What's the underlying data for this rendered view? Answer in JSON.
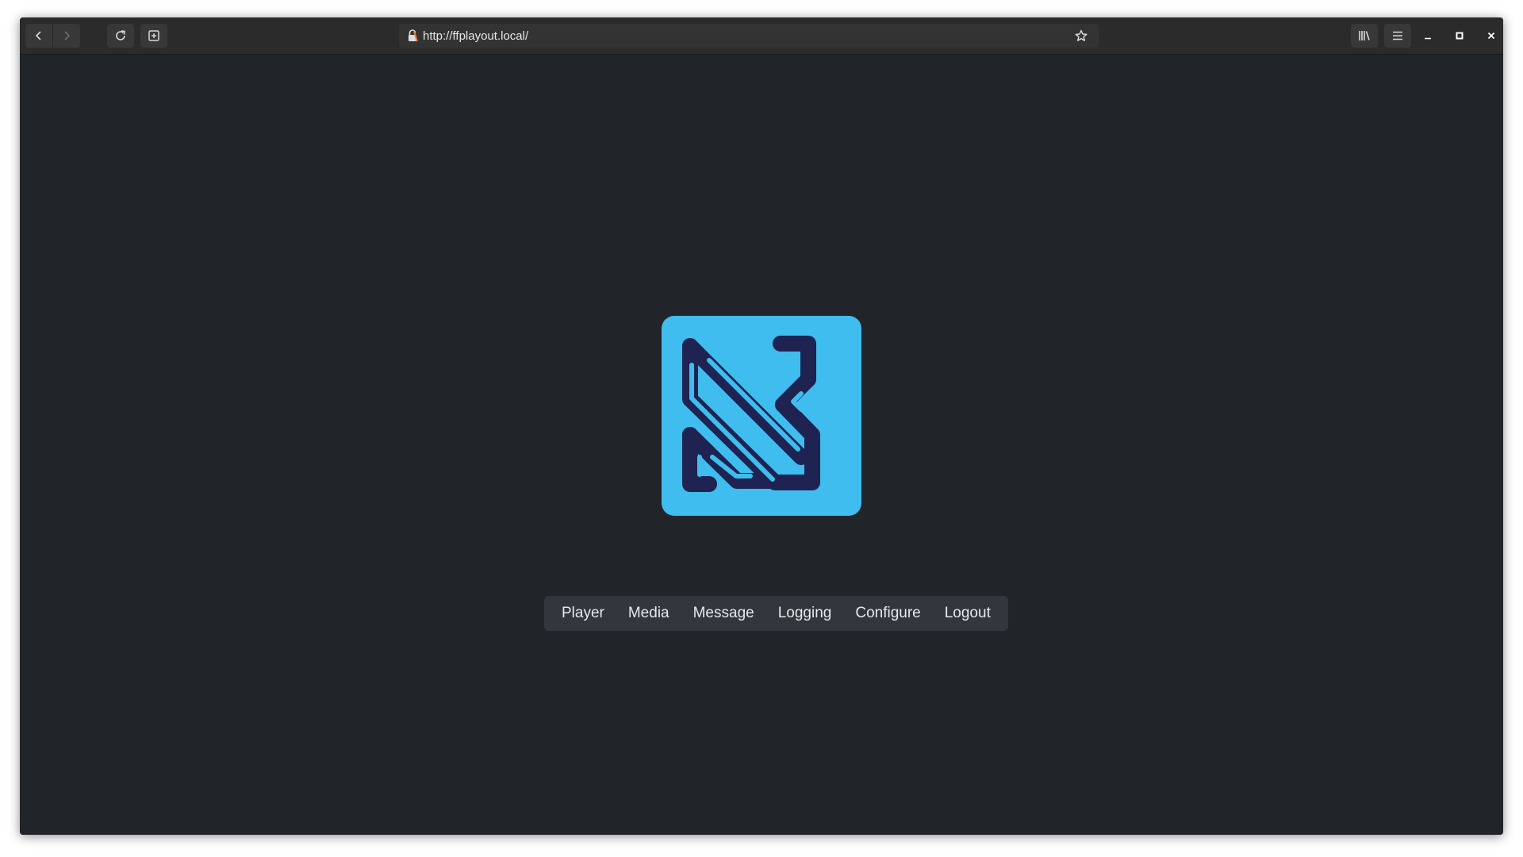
{
  "browser": {
    "url": "http://ffplayout.local/",
    "icons": {
      "back": "chevron-left-icon",
      "forward": "chevron-right-icon",
      "reload": "reload-icon",
      "new_tab": "new-tab-icon",
      "lock": "insecure-lock-icon",
      "bookmark": "star-icon",
      "library": "library-icon",
      "menu": "hamburger-menu-icon",
      "minimize": "minimize-icon",
      "maximize": "maximize-icon",
      "close": "close-icon"
    }
  },
  "page": {
    "logo": {
      "name": "ffplayout-logo",
      "bg_color": "#3fbdee",
      "mark_color": "#1e2352"
    },
    "nav": {
      "items": [
        {
          "label": "Player"
        },
        {
          "label": "Media"
        },
        {
          "label": "Message"
        },
        {
          "label": "Logging"
        },
        {
          "label": "Configure"
        },
        {
          "label": "Logout"
        }
      ]
    }
  },
  "colors": {
    "page_bg": "#212429",
    "toolbar_bg": "#2b2b2b",
    "menu_bg": "#33373d",
    "menu_text": "#e6e8ea"
  }
}
